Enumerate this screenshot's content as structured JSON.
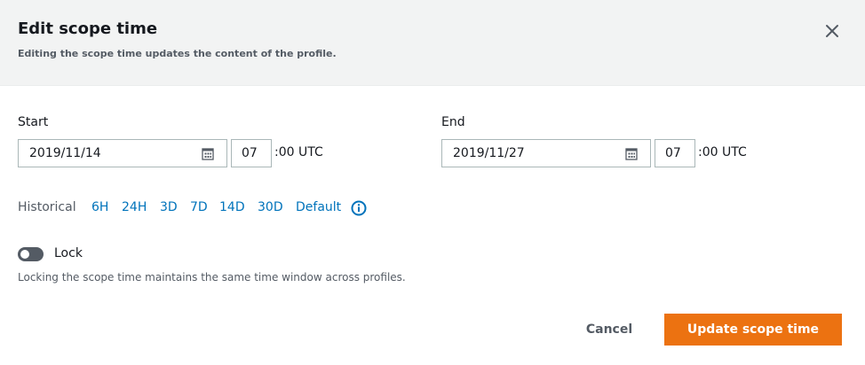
{
  "dialog": {
    "title": "Edit scope time",
    "subtitle": "Editing the scope time updates the content of the profile."
  },
  "start": {
    "label": "Start",
    "date": "2019/11/14",
    "hour": "07",
    "suffix": ":00 UTC"
  },
  "end": {
    "label": "End",
    "date": "2019/11/27",
    "hour": "07",
    "suffix": ":00 UTC"
  },
  "historical": {
    "label": "Historical",
    "options": [
      "6H",
      "24H",
      "3D",
      "7D",
      "14D",
      "30D",
      "Default"
    ]
  },
  "lock": {
    "label": "Lock",
    "enabled": false,
    "description": "Locking the scope time maintains the same time window across profiles."
  },
  "actions": {
    "cancel": "Cancel",
    "update": "Update scope time"
  },
  "colors": {
    "header_bg": "#f2f3f3",
    "link": "#0073bb",
    "primary_button": "#ec7211",
    "toggle_off": "#545b64"
  },
  "icons": {
    "close": "close-icon",
    "calendar": "calendar-icon",
    "info": "info-icon"
  }
}
